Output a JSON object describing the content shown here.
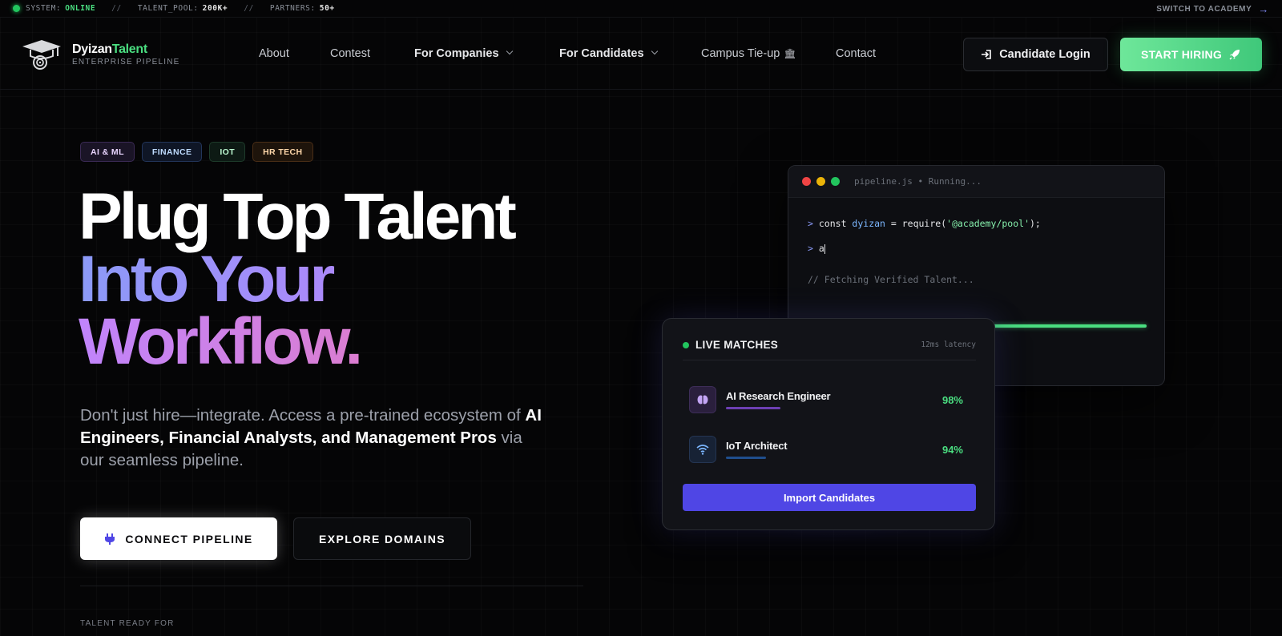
{
  "ticker": {
    "system_label": "SYSTEM:",
    "system_value": "ONLINE",
    "sep": "//",
    "talent_label": "TALENT_POOL:",
    "talent_value": "200K+",
    "partners_label": "PARTNERS:",
    "partners_value": "50+",
    "switch_label": "SWITCH TO ACADEMY",
    "switch_arrow": "→"
  },
  "brand": {
    "name_main": "Dyizan",
    "name_accent": "Talent",
    "tagline": "ENTERPRISE PIPELINE"
  },
  "nav": {
    "items": [
      "About",
      "Contest",
      "For Companies",
      "For Candidates",
      "Campus Tie-up",
      "Contact"
    ],
    "campus_icon": "🏛"
  },
  "actions": {
    "login": "Candidate Login",
    "start": "START HIRING"
  },
  "hero": {
    "tags": [
      "AI & ML",
      "FINANCE",
      "IOT",
      "HR TECH"
    ],
    "headline_1": "Plug Top Talent",
    "headline_2": "Into Your",
    "headline_3": "Workflow.",
    "sub_1": "Don't just hire—integrate. Access a pre-trained ecosystem of ",
    "sub_strong": "AI Engineers, Financial Analysts, and Management Pros",
    "sub_2": " via our seamless pipeline.",
    "cta_primary": "CONNECT PIPELINE",
    "cta_secondary": "EXPLORE DOMAINS",
    "ready_label": "TALENT READY FOR"
  },
  "code": {
    "filename": "pipeline.js • Running...",
    "prompt": ">",
    "line1_a": "const ",
    "line1_var": "dyizan",
    "line1_b": " = require(",
    "line1_str": "'@academy/pool'",
    "line1_c": ");",
    "line2": "a",
    "comment": "// Fetching Verified Talent...",
    "progress": 1.0
  },
  "live": {
    "title": "LIVE MATCHES",
    "latency": "12ms latency",
    "candidates": [
      {
        "name": "AI Research Engineer",
        "score": "98%",
        "icon": "brain-icon"
      },
      {
        "name": "IoT Architect",
        "score": "94%",
        "icon": "wifi-icon"
      }
    ],
    "import_label": "Import Candidates"
  },
  "colors": {
    "accent_green": "#4ade80",
    "accent_indigo": "#4f46e5",
    "background": "#050506"
  }
}
